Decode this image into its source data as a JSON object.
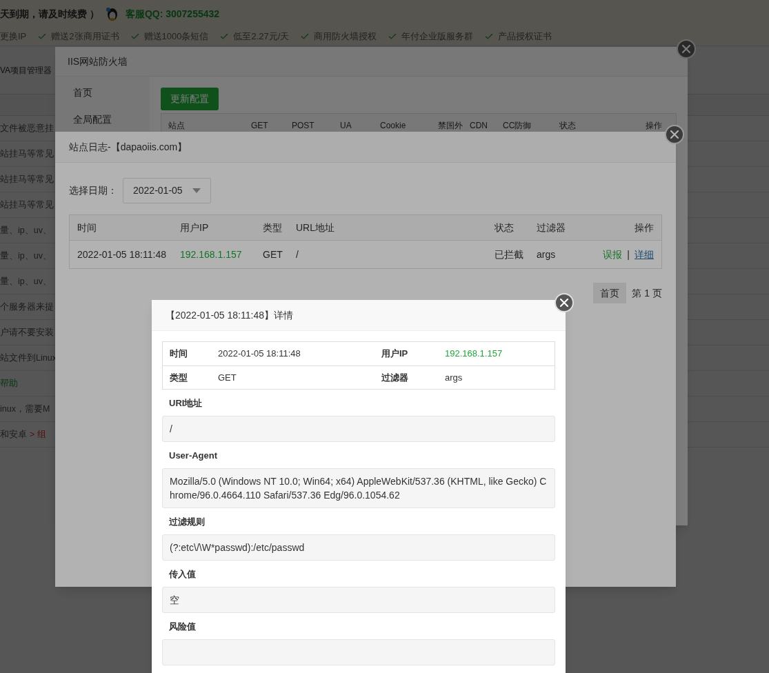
{
  "page": {
    "notice": "天到期，请及时续费 ）",
    "support": "客服QQ: 3007255432",
    "features": [
      {
        "label": "更换IP",
        "check": false
      },
      {
        "label": "赠送2张商用证书",
        "check": true
      },
      {
        "label": "赠送1000条短信",
        "check": true
      },
      {
        "label": "低至2.27元/天",
        "check": true
      },
      {
        "label": "商用防火墙授权",
        "check": true
      },
      {
        "label": "年付企业版服务群",
        "check": true
      },
      {
        "label": "产品授权证书",
        "check": true
      }
    ],
    "section_title": "VA项目管理器",
    "list_items": [
      {
        "kind": "text",
        "text": "文件被恶意挂"
      },
      {
        "kind": "text",
        "text": "站挂马等常见"
      },
      {
        "kind": "text",
        "text": "站挂马等常见"
      },
      {
        "kind": "text",
        "text": "站挂马等常见"
      },
      {
        "kind": "text",
        "text": "量、ip、uv、"
      },
      {
        "kind": "text",
        "text": "量、ip、uv、"
      },
      {
        "kind": "text",
        "text": "量、ip、uv、"
      },
      {
        "kind": "text",
        "text": "个服务器来提"
      },
      {
        "kind": "text",
        "text": "户请不要安装"
      },
      {
        "kind": "text",
        "text": "站文件到Linux"
      },
      {
        "kind": "link",
        "text": "帮助"
      },
      {
        "kind": "text",
        "text": "inux，需要M"
      },
      {
        "kind": "path",
        "text": "和安卓",
        "tail": "> 组"
      }
    ]
  },
  "firewall": {
    "title": "IIS网站防火墙",
    "menu": [
      "首页",
      "全局配置"
    ],
    "update_button": "更新配置",
    "columns": [
      "站点",
      "GET",
      "POST",
      "UA",
      "Cookie",
      "禁国外",
      "CDN",
      "CC防御",
      "状态",
      "操作"
    ]
  },
  "site_log": {
    "title": "站点日志-【dapaoiis.com】",
    "date_label": "选择日期：",
    "date_value": "2022-01-05",
    "columns": [
      "时间",
      "用户IP",
      "类型",
      "URL地址",
      "状态",
      "过滤器",
      "操作"
    ],
    "rows": [
      {
        "time": "2022-01-05 18:11:48",
        "ip": "192.168.1.157",
        "type": "GET",
        "url": "/",
        "status": "已拦截",
        "filter": "args",
        "actions": [
          {
            "kind": "report",
            "label": "误报"
          },
          {
            "kind": "detail",
            "label": "详细"
          }
        ],
        "separator": "|"
      }
    ],
    "pagination": {
      "first": "首页",
      "page": "第 1 页"
    }
  },
  "detail": {
    "title": "【2022-01-05 18:11:48】详情",
    "info": [
      [
        {
          "label": "时间",
          "value": "2022-01-05 18:11:48",
          "kind": "plain"
        },
        {
          "label": "用户IP",
          "value": "192.168.1.157",
          "kind": "ip"
        }
      ],
      [
        {
          "label": "类型",
          "value": "GET",
          "kind": "plain"
        },
        {
          "label": "过滤器",
          "value": "args",
          "kind": "plain"
        }
      ]
    ],
    "sections": [
      {
        "label": "URI地址",
        "value": "/"
      },
      {
        "label": "User-Agent",
        "value": "Mozilla/5.0 (Windows NT 10.0; Win64; x64) AppleWebKit/537.36 (KHTML, like Gecko) Chrome/96.0.4664.110 Safari/537.36 Edg/96.0.1054.62"
      },
      {
        "label": "过滤规则",
        "value": "(?:etc\\/\\W*passwd):/etc/passwd"
      },
      {
        "label": "传入值",
        "value": "空"
      },
      {
        "label": "风险值"
      }
    ]
  }
}
